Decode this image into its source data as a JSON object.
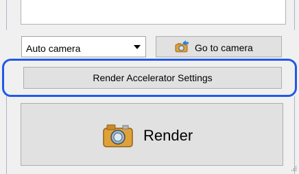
{
  "camera_select": {
    "value": "Auto camera"
  },
  "goto_camera_button": {
    "label": "Go to camera"
  },
  "render_accelerator_button": {
    "label": "Render Accelerator Settings"
  },
  "render_button": {
    "label": "Render"
  },
  "colors": {
    "highlight": "#1f59e6",
    "button_face": "#e1e1e1",
    "camera_icon": "#e0a238"
  },
  "icons": [
    "chevron-down-icon",
    "camera-arrow-icon",
    "camera-icon",
    "resize-grip-icon"
  ]
}
